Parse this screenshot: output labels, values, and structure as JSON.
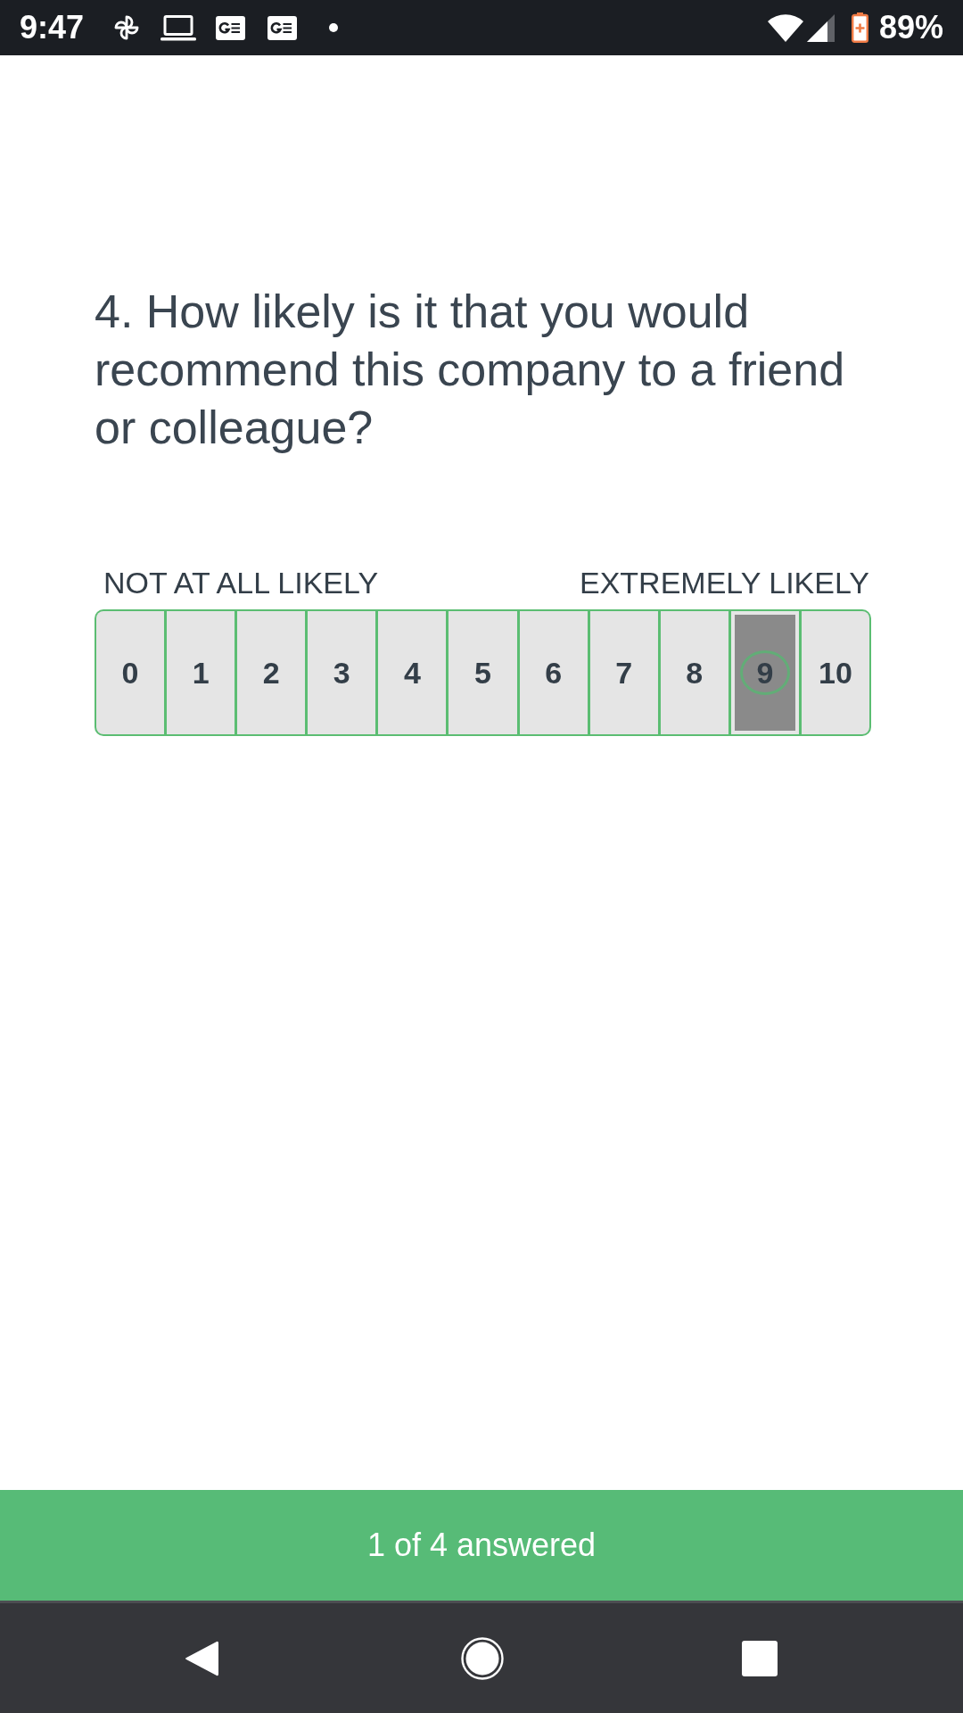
{
  "status_bar": {
    "time": "9:47",
    "battery_text": "89%"
  },
  "question": {
    "text": "4. How likely is it that you would recommend this company to a friend or colleague?",
    "scale": {
      "low_label": "NOT AT ALL LIKELY",
      "high_label": "EXTREMELY LIKELY",
      "options": [
        {
          "label": "0",
          "selected": false
        },
        {
          "label": "1",
          "selected": false
        },
        {
          "label": "2",
          "selected": false
        },
        {
          "label": "3",
          "selected": false
        },
        {
          "label": "4",
          "selected": false
        },
        {
          "label": "5",
          "selected": false
        },
        {
          "label": "6",
          "selected": false
        },
        {
          "label": "7",
          "selected": false
        },
        {
          "label": "8",
          "selected": false
        },
        {
          "label": "9",
          "selected": true
        },
        {
          "label": "10",
          "selected": false
        }
      ]
    }
  },
  "footer": {
    "progress_text": "1 of 4 answered"
  }
}
